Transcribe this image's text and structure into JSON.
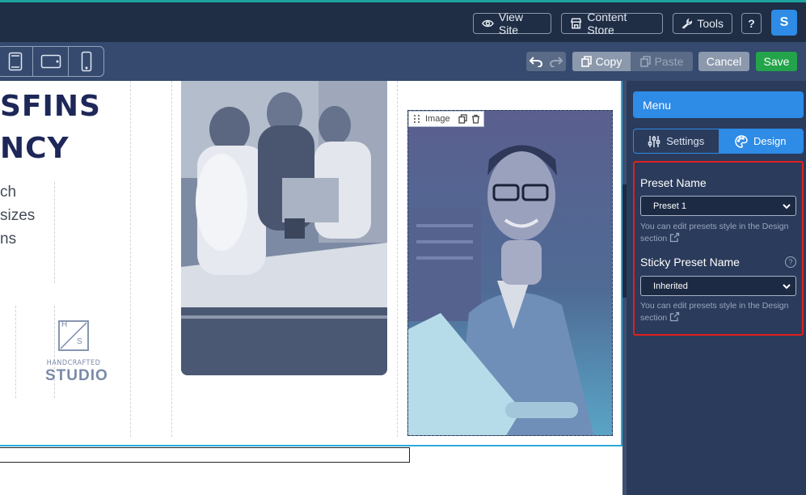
{
  "topbar": {
    "view_site": "View Site",
    "content_store": "Content Store",
    "tools": "Tools",
    "help": "?",
    "user_initial": "S"
  },
  "toolbar": {
    "copy": "Copy",
    "paste": "Paste",
    "cancel": "Cancel",
    "save": "Save"
  },
  "canvas": {
    "heading_line1": "SFINS",
    "heading_line2": "NCY",
    "body_lines": [
      "ch",
      " sizes",
      "ns"
    ],
    "logo_letters_top": "H",
    "logo_letters_bottom": "S",
    "logo_line1": "HANDCRAFTED",
    "logo_line2": "STUDIO",
    "image_tag_label": "Image"
  },
  "panel": {
    "menu_label": "Menu",
    "tabs": [
      {
        "label": "Settings",
        "icon": "sliders-icon"
      },
      {
        "label": "Design",
        "icon": "palette-icon"
      }
    ],
    "preset": {
      "label": "Preset Name",
      "value": "Preset 1",
      "hint": "You can edit presets style in the Design section"
    },
    "sticky_preset": {
      "label": "Sticky Preset Name",
      "value": "Inherited",
      "hint": "You can edit presets style in the Design section"
    }
  },
  "colors": {
    "topbar_bg": "#1f2d45",
    "toolbar_bg": "#354a6e",
    "panel_bg": "#2b3b5b",
    "accent_blue": "#2e8be6",
    "save_green": "#23a34a",
    "highlight_red": "#e0201f",
    "heading_navy": "#1d2758"
  }
}
